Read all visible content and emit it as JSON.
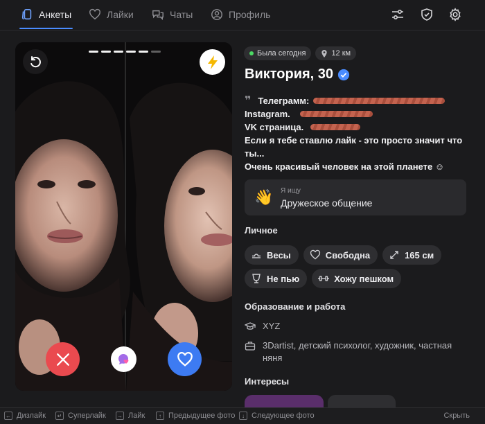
{
  "nav": {
    "tabs": [
      {
        "label": "Анкеты",
        "icon": "cards-icon",
        "active": true
      },
      {
        "label": "Лайки",
        "icon": "heart-icon",
        "active": false
      },
      {
        "label": "Чаты",
        "icon": "chat-bubbles-icon",
        "active": false
      },
      {
        "label": "Профиль",
        "icon": "user-circle-icon",
        "active": false
      }
    ],
    "tools": [
      "sliders-icon",
      "shield-check-icon",
      "gear-icon"
    ]
  },
  "photo": {
    "total_photos": 6,
    "current_photo": 5,
    "actions": [
      "undo-icon",
      "lightning-icon",
      "close-icon",
      "superlike-icon",
      "heart-icon"
    ]
  },
  "profile": {
    "status": "Была сегодня",
    "distance": "12 км",
    "name_age": "Виктория, 30",
    "verified": true,
    "bio": {
      "telegram": "Телеграмм:",
      "instagram": "Instagram.",
      "vk": "VK страница.",
      "line4": "Если я тебе ставлю лайк - это просто значит что",
      "line5": "ты...",
      "line6": "Очень красивый человек на этой планете ☺"
    },
    "looking_for": {
      "caption": "Я ищу",
      "value": "Дружеское общение",
      "emoji": "👋"
    },
    "personal_title": "Личное",
    "personal": [
      {
        "label": "Весы",
        "icon": "zodiac-icon"
      },
      {
        "label": "Свободна",
        "icon": "heart-outline-icon"
      },
      {
        "label": "165 см",
        "icon": "height-arrows-icon"
      },
      {
        "label": "Не пью",
        "icon": "glass-icon"
      },
      {
        "label": "Хожу пешком",
        "icon": "dumbbell-icon"
      }
    ],
    "education_title": "Образование и работа",
    "education": "XYZ",
    "work": "3Dartist, детский психолог, художник, частная няня",
    "interests_title": "Интересы"
  },
  "hotkeys": {
    "dislike": "Дизлайк",
    "superlike": "Суперлайк",
    "like": "Лайк",
    "prev": "Предыдущее фото",
    "next": "Следующее фото",
    "hide": "Скрыть"
  },
  "colors": {
    "accent": "#4a8cff",
    "dislike": "#ea4a4f",
    "like": "#3d7bf2",
    "boost": "#f5b800",
    "online": "#4cd964"
  }
}
